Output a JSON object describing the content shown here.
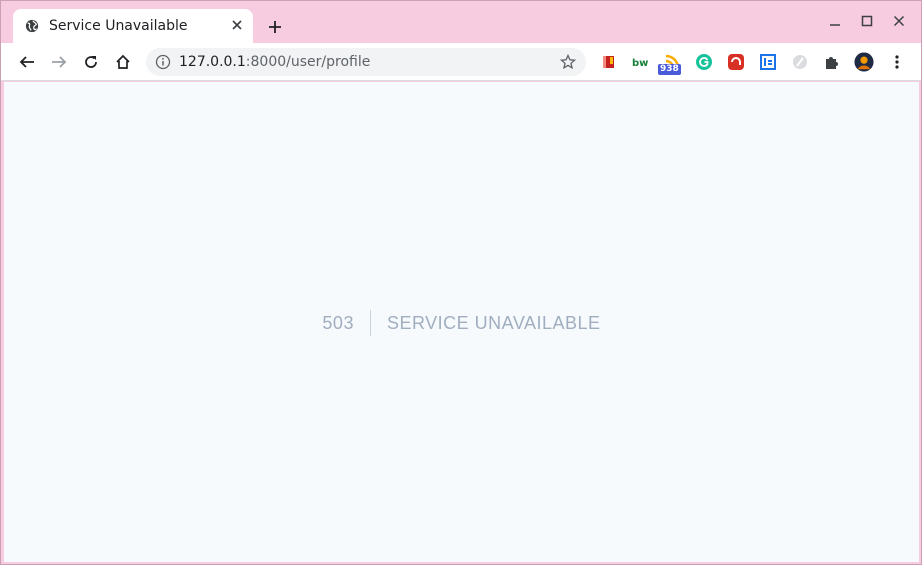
{
  "tab": {
    "title": "Service Unavailable",
    "favicon": "globe-icon"
  },
  "omnibox": {
    "host": "127.0.0.1",
    "path": ":8000/user/profile"
  },
  "extensions": [
    {
      "name": "book-extension-icon",
      "color": "#d93025"
    },
    {
      "name": "bw-extension-icon",
      "label": "bw",
      "color": "#188038"
    },
    {
      "name": "rss-extension-icon",
      "badge": "938",
      "color": "#f9ab00"
    },
    {
      "name": "grammarly-extension-icon",
      "color": "#15c39a"
    },
    {
      "name": "red-extension-icon",
      "color": "#d93025"
    },
    {
      "name": "blue-extension-icon",
      "color": "#1a73e8"
    },
    {
      "name": "grey-extension-icon",
      "color": "#bdc1c6"
    },
    {
      "name": "puzzle-icon",
      "color": "#3c4043"
    }
  ],
  "page": {
    "code": "503",
    "message": "Service Unavailable"
  }
}
